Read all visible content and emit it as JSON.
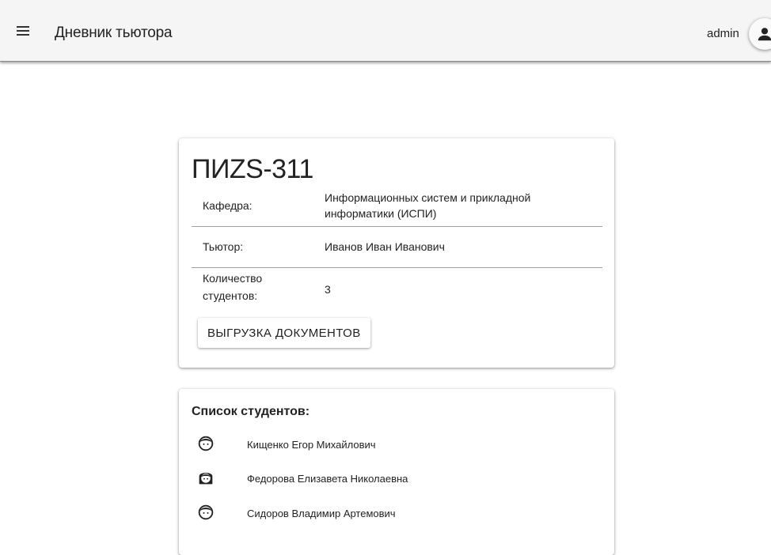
{
  "appbar": {
    "title": "Дневник тьютора",
    "user": "admin"
  },
  "group": {
    "name": "ПИZS-311",
    "rows": [
      {
        "label": "Кафедра:",
        "value_line1": "Информационных систем и прикладной",
        "value_line2": "информатики (ИСПИ)"
      },
      {
        "label": "Тьютор:",
        "value": "Иванов Иван Иванович"
      },
      {
        "label_line1": "Количество",
        "label_line2": "студентов:",
        "value": "3"
      }
    ],
    "export_button": "ВЫГРУЗКА ДОКУМЕНТОВ"
  },
  "students": {
    "title": "Список студентов:",
    "items": [
      {
        "name": "Кищенко Егор Михайлович",
        "icon": "boy-face-icon"
      },
      {
        "name": "Федорова Елизавета Николаевна",
        "icon": "girl-face-icon"
      },
      {
        "name": "Сидоров Владимир Артемович",
        "icon": "boy-face-icon"
      }
    ]
  }
}
